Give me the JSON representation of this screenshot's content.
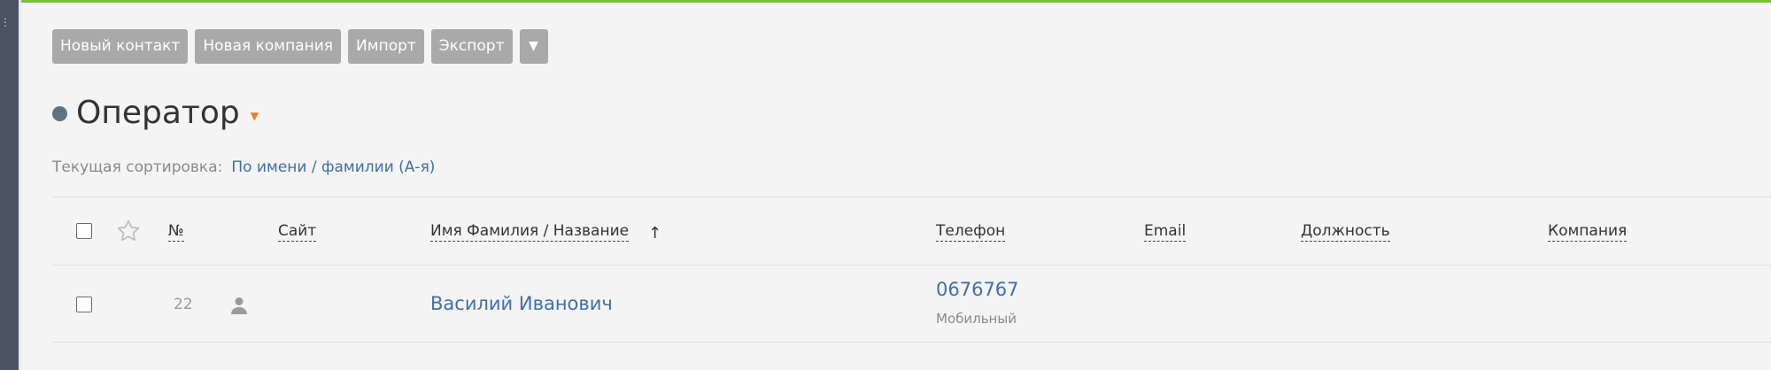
{
  "colors": {
    "accent_green": "#7dbe3c",
    "rail": "#4b5363",
    "button_bg": "#a9a9a9",
    "link": "#3f6fa8",
    "caret": "#f07c2a"
  },
  "toolbar": {
    "new_contact": "Новый контакт",
    "new_company": "Новая компания",
    "import": "Импорт",
    "export": "Экспорт",
    "more": "▼"
  },
  "page": {
    "title": "Оператор"
  },
  "sort": {
    "label": "Текущая сортировка:",
    "value": "По имени / фамилии (А-я)"
  },
  "table": {
    "headers": {
      "number": "№",
      "site": "Сайт",
      "name": "Имя Фамилия / Название",
      "phone": "Телефон",
      "email": "Email",
      "position": "Должность",
      "company": "Компания"
    },
    "rows": [
      {
        "number": "22",
        "name": "Василий Иванович",
        "phone": "0676767",
        "phone_type": "Мобильный"
      }
    ]
  },
  "icons": {
    "favorite": "star-outline-icon",
    "contact_type": "person-icon",
    "sort_direction": "arrow-up-icon",
    "title_menu": "caret-down-icon",
    "rail_handle": "grip-icon"
  }
}
